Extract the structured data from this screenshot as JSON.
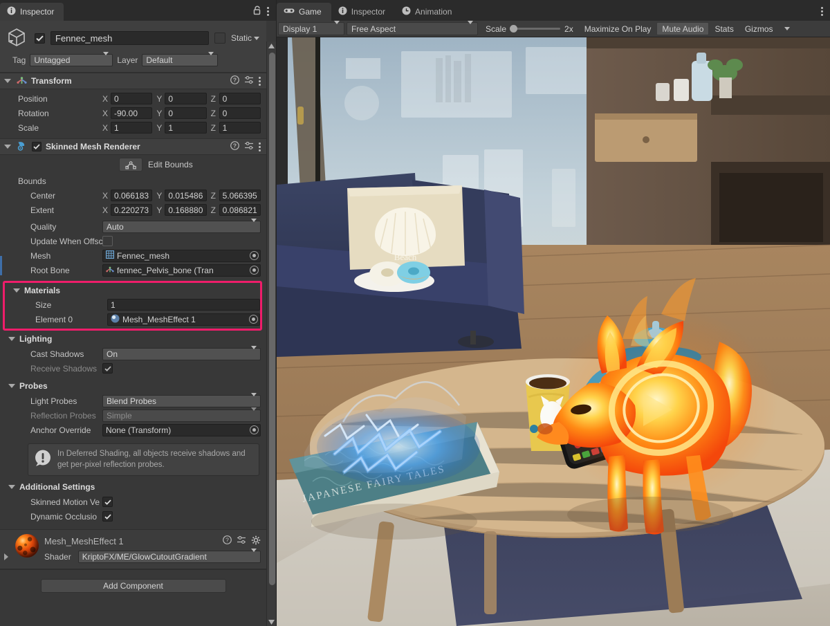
{
  "inspector": {
    "tab_label": "Inspector",
    "tab_icon": "info-icon",
    "lock_icon": "lock-open-icon",
    "menu_icon": "kebab-menu-icon",
    "object": {
      "name_value": "Fennec_mesh",
      "name_placeholder": "Name",
      "enabled": true,
      "static_label": "Static",
      "tag_label": "Tag",
      "tag_value": "Untagged",
      "layer_label": "Layer",
      "layer_value": "Default"
    },
    "transform": {
      "title": "Transform",
      "rows": [
        {
          "label": "Position",
          "x": "0",
          "y": "0",
          "z": "0"
        },
        {
          "label": "Rotation",
          "x": "-90.00",
          "y": "0",
          "z": "0"
        },
        {
          "label": "Scale",
          "x": "1",
          "y": "1",
          "z": "1"
        }
      ],
      "axis_x": "X",
      "axis_y": "Y",
      "axis_z": "Z"
    },
    "skinned_mesh_renderer": {
      "title": "Skinned Mesh Renderer",
      "enabled": true,
      "edit_bounds_label": "Edit Bounds",
      "bounds_label": "Bounds",
      "bounds_rows": [
        {
          "label": "Center",
          "x": "0.066183",
          "y": "0.015486",
          "z": "5.066395"
        },
        {
          "label": "Extent",
          "x": "0.220273",
          "y": "0.168880",
          "z": "0.086821"
        }
      ],
      "quality_label": "Quality",
      "quality_value": "Auto",
      "update_offscreen_label": "Update When Offscre",
      "update_offscreen_checked": false,
      "mesh_label": "Mesh",
      "mesh_value": "Fennec_mesh",
      "root_bone_label": "Root Bone",
      "root_bone_value": "fennec_Pelvis_bone (Tran"
    },
    "materials": {
      "title": "Materials",
      "highlight_color": "#ef1d6a",
      "size_label": "Size",
      "size_value": "1",
      "element_label": "Element 0",
      "element_value": "Mesh_MeshEffect 1"
    },
    "lighting": {
      "title": "Lighting",
      "cast_shadows_label": "Cast Shadows",
      "cast_shadows_value": "On",
      "receive_shadows_label": "Receive Shadows",
      "receive_shadows_checked": true
    },
    "probes": {
      "title": "Probes",
      "light_probes_label": "Light Probes",
      "light_probes_value": "Blend Probes",
      "reflection_probes_label": "Reflection Probes",
      "reflection_probes_value": "Simple",
      "anchor_override_label": "Anchor Override",
      "anchor_override_value": "None (Transform)"
    },
    "help_box": {
      "icon": "warning-icon",
      "text": "In Deferred Shading, all objects receive shadows and get per-pixel reflection probes."
    },
    "additional_settings": {
      "title": "Additional Settings",
      "skinned_motion_label": "Skinned Motion Ve",
      "skinned_motion_checked": true,
      "dynamic_occlusion_label": "Dynamic Occlusio",
      "dynamic_occlusion_checked": true
    },
    "material_footer": {
      "name": "Mesh_MeshEffect 1",
      "shader_label": "Shader",
      "shader_value": "KriptoFX/ME/GlowCutoutGradient",
      "help_icon": "help-icon",
      "preset_icon": "preset-icon",
      "gear_icon": "gear-icon"
    },
    "add_component_label": "Add Component"
  },
  "game_panel": {
    "tabs": [
      {
        "label": "Game",
        "icon": "gamepad-icon",
        "active": true
      },
      {
        "label": "Inspector",
        "icon": "info-icon",
        "active": false
      },
      {
        "label": "Animation",
        "icon": "clock-icon",
        "active": false
      }
    ],
    "menu_icon": "kebab-menu-icon",
    "toolbar": {
      "display_value": "Display 1",
      "aspect_value": "Free Aspect",
      "scale_label": "Scale",
      "scale_value": "2x",
      "maximize_label": "Maximize On Play",
      "mute_audio_label": "Mute Audio",
      "stats_label": "Stats",
      "gizmos_label": "Gizmos"
    },
    "scene": {
      "description": "Rendered 3D living-room scene",
      "pillow_text": "Beach",
      "book_title": "JAPANESE FAIRY TALES",
      "objects": [
        "navy-sofa",
        "beach-pillow",
        "donut-plate",
        "floor-lamp",
        "curtain",
        "wooden-coffee-table",
        "glowing-fox",
        "blue-teapot",
        "coffee-cup",
        "tv-remote",
        "electric-book",
        "shelf-unit",
        "rug"
      ]
    }
  }
}
